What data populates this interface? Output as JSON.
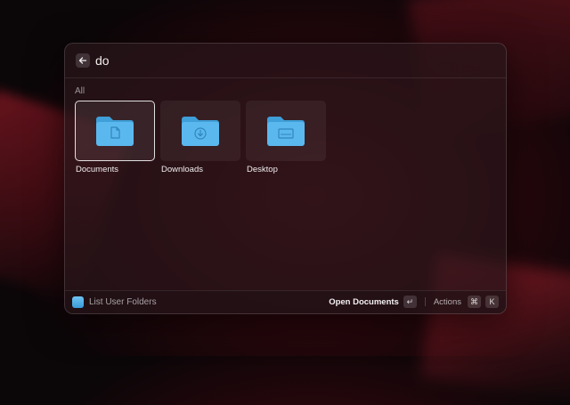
{
  "search": {
    "query": "do",
    "placeholder": ""
  },
  "section": {
    "label": "All"
  },
  "items": [
    {
      "label": "Documents",
      "icon": "folder-document-icon",
      "selected": true
    },
    {
      "label": "Downloads",
      "icon": "folder-download-icon",
      "selected": false
    },
    {
      "label": "Desktop",
      "icon": "folder-desktop-icon",
      "selected": false
    }
  ],
  "footer": {
    "title": "List User Folders",
    "primary_action": "Open Documents",
    "primary_key": "↵",
    "actions_label": "Actions",
    "actions_keys": [
      "⌘",
      "K"
    ]
  },
  "colors": {
    "folder": "#5bb8ee",
    "folder_dark": "#3f9fd8",
    "accent_border": "#ffffff"
  }
}
